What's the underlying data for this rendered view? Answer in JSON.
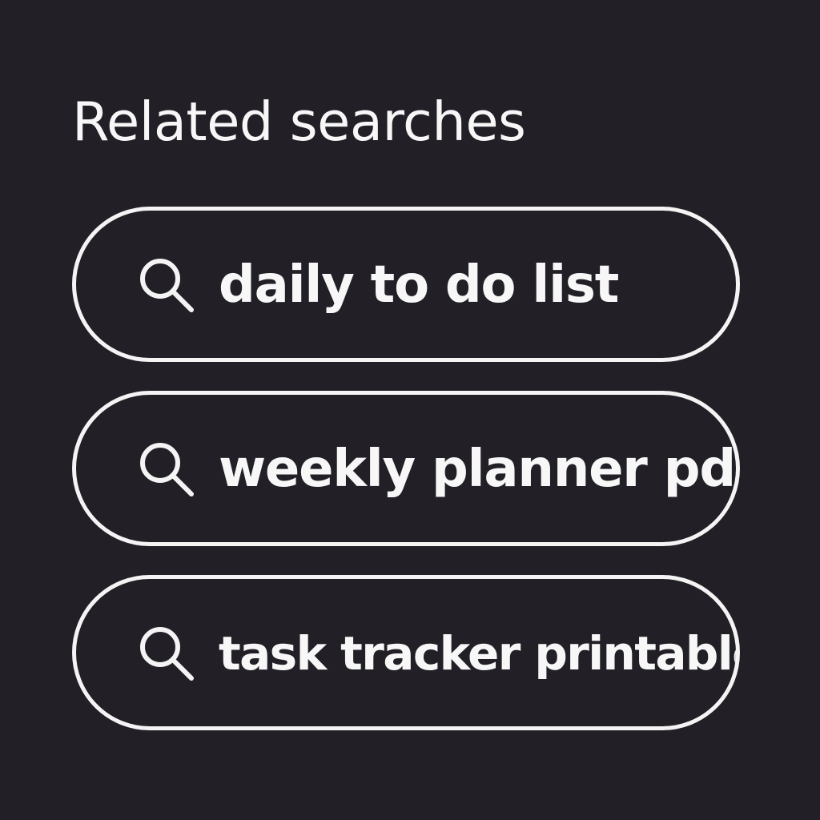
{
  "related_searches": {
    "title": "Related searches",
    "items": [
      {
        "label": "daily to do list",
        "icon": "search-icon"
      },
      {
        "label": "weekly planner pdf",
        "icon": "search-icon"
      },
      {
        "label": "task tracker printable",
        "icon": "search-icon"
      }
    ]
  },
  "colors": {
    "background": "#221f26",
    "foreground": "#f7f7f7",
    "pill_border": "#f4f4f4"
  }
}
